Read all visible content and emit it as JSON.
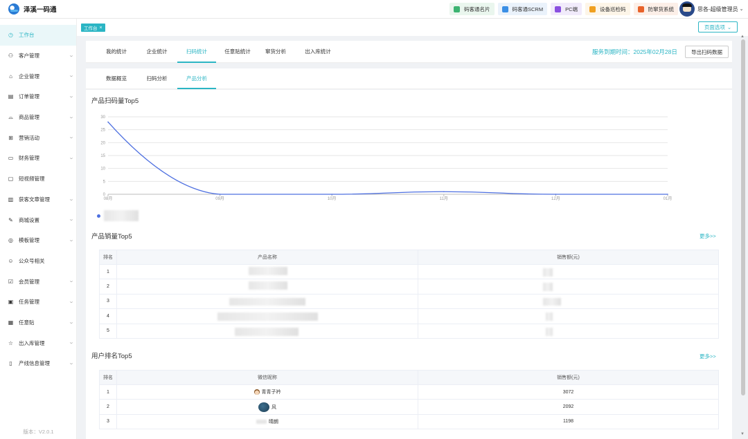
{
  "app": {
    "title": "泽溪一码通"
  },
  "top_links": [
    {
      "label": "码客通名片",
      "color": "#3cb371",
      "bg": "#eaf6ee"
    },
    {
      "label": "码客通SCRM",
      "color": "#3b8fe5",
      "bg": "#eaf2fb"
    },
    {
      "label": "PC端",
      "color": "#8a4fe0",
      "bg": "#f1ebfb"
    },
    {
      "label": "设备巡检码",
      "color": "#f0a020",
      "bg": "#fdf5e8"
    },
    {
      "label": "防窜货系统",
      "color": "#e8622a",
      "bg": "#fcefe8"
    }
  ],
  "user": {
    "name": "思各-超级管理员"
  },
  "sidebar": {
    "items": [
      {
        "label": "工作台",
        "icon": "◷",
        "icon_name": "dashboard-icon",
        "active": true,
        "chevron": false
      },
      {
        "label": "客户管理",
        "icon": "⚇",
        "icon_name": "customer-icon",
        "chevron": true
      },
      {
        "label": "企业管理",
        "icon": "⌂",
        "icon_name": "enterprise-icon",
        "chevron": true
      },
      {
        "label": "订单管理",
        "icon": "▤",
        "icon_name": "order-icon",
        "chevron": true
      },
      {
        "label": "商品管理",
        "icon": "⌓",
        "icon_name": "goods-icon",
        "chevron": true
      },
      {
        "label": "营销活动",
        "icon": "⊞",
        "icon_name": "gift-icon",
        "chevron": true
      },
      {
        "label": "财务管理",
        "icon": "▭",
        "icon_name": "finance-icon",
        "chevron": true
      },
      {
        "label": "短视频管理",
        "icon": "▢",
        "icon_name": "video-icon",
        "chevron": false
      },
      {
        "label": "获客文章管理",
        "icon": "▥",
        "icon_name": "article-icon",
        "chevron": true
      },
      {
        "label": "商城设置",
        "icon": "✎",
        "icon_name": "mall-settings-icon",
        "chevron": true
      },
      {
        "label": "模板管理",
        "icon": "◎",
        "icon_name": "template-icon",
        "chevron": true
      },
      {
        "label": "公众号相关",
        "icon": "☺",
        "icon_name": "wechat-official-icon",
        "chevron": false
      },
      {
        "label": "会员管理",
        "icon": "☑",
        "icon_name": "member-icon",
        "chevron": true
      },
      {
        "label": "任务管理",
        "icon": "▣",
        "icon_name": "task-icon",
        "chevron": true
      },
      {
        "label": "任意贴",
        "icon": "▦",
        "icon_name": "sticker-icon",
        "chevron": true
      },
      {
        "label": "出入库管理",
        "icon": "☆",
        "icon_name": "inventory-icon",
        "chevron": true
      },
      {
        "label": "产线信息管理",
        "icon": "▯",
        "icon_name": "production-line-icon",
        "chevron": true
      }
    ],
    "version": "版本：V2.0.1"
  },
  "tagbar": {
    "tag": "工作台",
    "page_options": "页面选项"
  },
  "tabs1": {
    "items": [
      "我的统计",
      "企业统计",
      "扫码统计",
      "任意贴统计",
      "窜货分析",
      "出入库统计"
    ],
    "active": 2,
    "service_expiry": "服务到期时间：2025年02月28日",
    "export_label": "导出扫码数据"
  },
  "tabs2": {
    "items": [
      "数据概览",
      "扫码分析",
      "产品分析"
    ],
    "active": 2
  },
  "sections": {
    "scan_top5": "产品扫码量Top5",
    "sales_top5": "产品销量Top5",
    "user_top5": "用户排名Top5",
    "more": "更多>>"
  },
  "chart_data": {
    "type": "line",
    "title": "产品扫码量Top5",
    "categories": [
      "08月",
      "09月",
      "10月",
      "11月",
      "12月",
      "01月"
    ],
    "series": [
      {
        "values": [
          28,
          0,
          0,
          1,
          0,
          0
        ]
      }
    ],
    "ylim": [
      0,
      30
    ],
    "yticks": [
      0,
      5,
      10,
      15,
      20,
      25,
      30
    ],
    "grid": true,
    "color": "#4d6fe0"
  },
  "sales_table": {
    "headers": [
      "排名",
      "产品名称",
      "销售额(元)"
    ],
    "rows": [
      {
        "rank": "1"
      },
      {
        "rank": "2"
      },
      {
        "rank": "3"
      },
      {
        "rank": "4"
      },
      {
        "rank": "5"
      }
    ]
  },
  "user_table": {
    "headers": [
      "排名",
      "微信昵称",
      "销售额(元)"
    ],
    "rows": [
      {
        "rank": "1",
        "name": "青青子衿",
        "amount": "3072"
      },
      {
        "rank": "2",
        "name": "风",
        "amount": "2092"
      },
      {
        "rank": "3",
        "name": "晴朗",
        "amount": "1198"
      }
    ]
  }
}
